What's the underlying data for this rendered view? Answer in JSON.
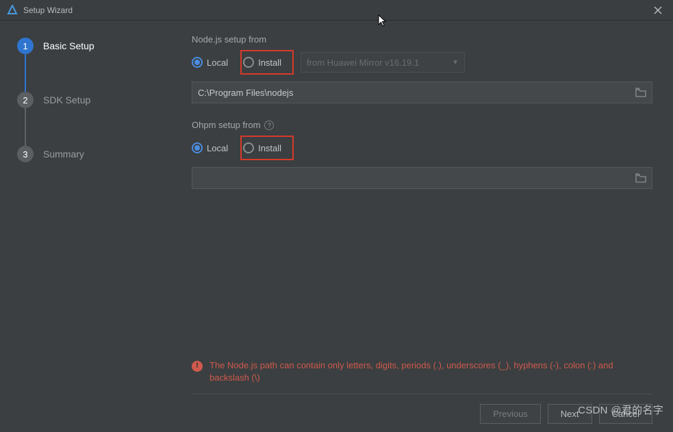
{
  "window": {
    "title": "Setup Wizard"
  },
  "steps": [
    {
      "num": "1",
      "label": "Basic Setup",
      "active": true
    },
    {
      "num": "2",
      "label": "SDK Setup",
      "active": false
    },
    {
      "num": "3",
      "label": "Summary",
      "active": false
    }
  ],
  "nodejs": {
    "section_label": "Node.js setup from",
    "local_label": "Local",
    "install_label": "Install",
    "selected": "local",
    "mirror_label": "from Huawei Mirror v16.19.1",
    "path": "C:\\Program Files\\nodejs"
  },
  "ohpm": {
    "section_label": "Ohpm setup from",
    "local_label": "Local",
    "install_label": "Install",
    "selected": "local",
    "path": ""
  },
  "error": {
    "message": "The Node.js path can contain only letters, digits, periods (.), underscores (_), hyphens (-), colon (:) and backslash (\\)"
  },
  "footer": {
    "previous": "Previous",
    "next": "Next",
    "cancel": "Cancel"
  },
  "watermark": "CSDN @君的名字"
}
